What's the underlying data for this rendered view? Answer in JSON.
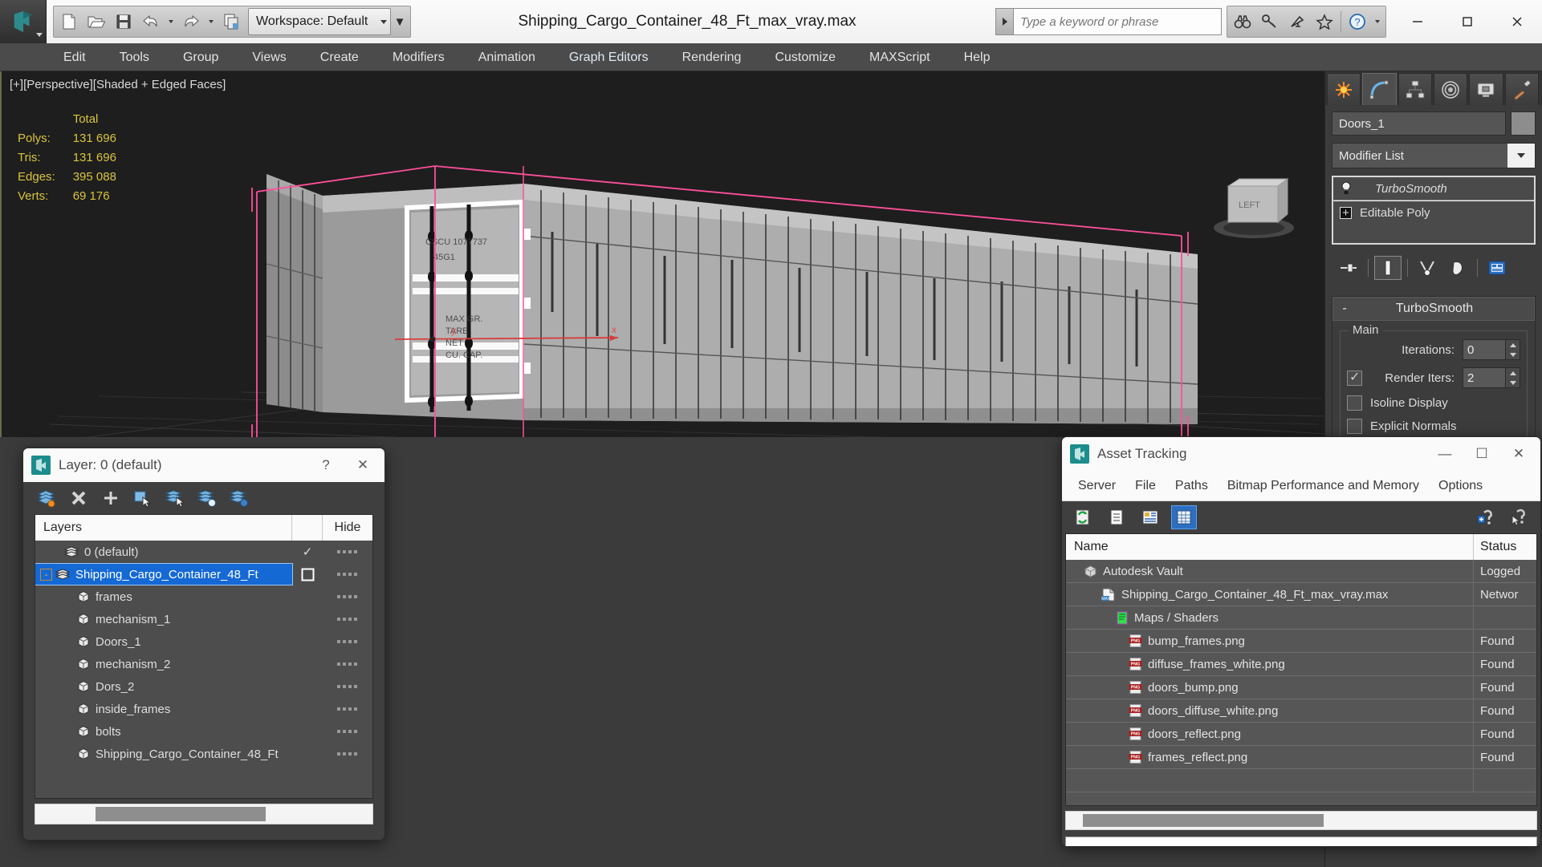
{
  "titlebar": {
    "document_title": "Shipping_Cargo_Container_48_Ft_max_vray.max",
    "workspace_label": "Workspace: Default",
    "search_placeholder": "Type a keyword or phrase",
    "quick_access": [
      "new-file-icon",
      "open-file-icon",
      "save-file-icon",
      "undo-icon",
      "redo-icon",
      "project-folder-icon"
    ],
    "help_icons": [
      "binoculars-icon",
      "key-icon",
      "satellite-dish-icon",
      "star-icon",
      "question-help-icon"
    ],
    "window_controls": [
      "minimize",
      "maximize",
      "close"
    ]
  },
  "menubar": {
    "items": [
      "Edit",
      "Tools",
      "Group",
      "Views",
      "Create",
      "Modifiers",
      "Animation",
      "Graph Editors",
      "Rendering",
      "Customize",
      "MAXScript",
      "Help"
    ]
  },
  "viewport": {
    "label": "[+][Perspective][Shaded + Edged Faces]",
    "stats": {
      "header": "Total",
      "rows": [
        {
          "label": "Polys:",
          "value": "131 696"
        },
        {
          "label": "Tris:",
          "value": "131 696"
        },
        {
          "label": "Edges:",
          "value": "395 088"
        },
        {
          "label": "Verts:",
          "value": "69 176"
        }
      ]
    },
    "axis": {
      "x": "x",
      "y": "y"
    },
    "viewcube_label": "LEFT",
    "selection_color": "#ff4f9a",
    "stat_color": "#d8c43c"
  },
  "command_panel": {
    "tabs": [
      "create-tab-icon",
      "modify-tab-icon",
      "hierarchy-tab-icon",
      "motion-tab-icon",
      "display-tab-icon",
      "utilities-tab-icon"
    ],
    "active_tab_index": 1,
    "object_name": "Doors_1",
    "modifier_list_label": "Modifier List",
    "stack": [
      {
        "label": "TurboSmooth",
        "icon": "lightbulb-icon",
        "italic": true
      },
      {
        "label": "Editable Poly",
        "icon": "plus-box-icon",
        "italic": false
      }
    ],
    "stack_tools": [
      "pin-stack-icon",
      "show-end-result-icon",
      "make-unique-icon",
      "remove-modifier-icon",
      "configure-sets-icon"
    ],
    "rollout": {
      "minus": "-",
      "title": "TurboSmooth",
      "group_label": "Main",
      "iterations_label": "Iterations:",
      "iterations_value": "0",
      "render_iters_label": "Render Iters:",
      "render_iters_value": "2",
      "render_iters_checked": true,
      "isoline_label": "Isoline Display",
      "isoline_checked": false,
      "explicit_label": "Explicit Normals",
      "explicit_checked": false
    }
  },
  "layer_dialog": {
    "title": "Layer: 0 (default)",
    "titlebar_buttons": [
      "?",
      "✕"
    ],
    "tools": [
      "new-layer-icon",
      "delete-layer-icon",
      "add-layer-icon",
      "select-objects-icon",
      "select-highlighted-icon",
      "highlight-selected-icon",
      "layer-properties-icon"
    ],
    "columns": {
      "name": "Layers",
      "hide": "Hide"
    },
    "rows": [
      {
        "name": "0 (default)",
        "icon": "layer-icon",
        "indent": 1,
        "selected": false,
        "check": "✓",
        "expander": null
      },
      {
        "name": "Shipping_Cargo_Container_48_Ft",
        "icon": "layer-icon",
        "indent": 1,
        "selected": true,
        "check": "square",
        "expander": "-"
      },
      {
        "name": "frames",
        "icon": "object-icon",
        "indent": 2,
        "selected": false,
        "check": null,
        "expander": null
      },
      {
        "name": "mechanism_1",
        "icon": "object-icon",
        "indent": 2,
        "selected": false,
        "check": null,
        "expander": null
      },
      {
        "name": "Doors_1",
        "icon": "object-icon",
        "indent": 2,
        "selected": false,
        "check": null,
        "expander": null
      },
      {
        "name": "mechanism_2",
        "icon": "object-icon",
        "indent": 2,
        "selected": false,
        "check": null,
        "expander": null
      },
      {
        "name": "Dors_2",
        "icon": "object-icon",
        "indent": 2,
        "selected": false,
        "check": null,
        "expander": null
      },
      {
        "name": "inside_frames",
        "icon": "object-icon",
        "indent": 2,
        "selected": false,
        "check": null,
        "expander": null
      },
      {
        "name": "bolts",
        "icon": "object-icon",
        "indent": 2,
        "selected": false,
        "check": null,
        "expander": null
      },
      {
        "name": "Shipping_Cargo_Container_48_Ft",
        "icon": "object-icon",
        "indent": 2,
        "selected": false,
        "check": null,
        "expander": null
      }
    ]
  },
  "asset_dialog": {
    "title": "Asset Tracking",
    "menu": [
      "Server",
      "File",
      "Paths",
      "Bitmap Performance and Memory",
      "Options"
    ],
    "tools": [
      "refresh-icon",
      "list-view-icon",
      "detail-view-icon",
      "grid-view-icon"
    ],
    "tools_right": [
      "add-help-icon",
      "help-cursor-icon"
    ],
    "active_tool_index": 3,
    "columns": {
      "name": "Name",
      "status": "Status"
    },
    "rows": [
      {
        "name": "Autodesk Vault",
        "status": "Logged",
        "icon": "vault-icon",
        "indent": 1
      },
      {
        "name": "Shipping_Cargo_Container_48_Ft_max_vray.max",
        "status": "Networ",
        "icon": "max-file-icon",
        "indent": 2
      },
      {
        "name": "Maps / Shaders",
        "status": "",
        "icon": "maps-shaders-icon",
        "indent": 3
      },
      {
        "name": "bump_frames.png",
        "status": "Found",
        "icon": "png-icon",
        "indent": 4
      },
      {
        "name": "diffuse_frames_white.png",
        "status": "Found",
        "icon": "png-icon",
        "indent": 4
      },
      {
        "name": "doors_bump.png",
        "status": "Found",
        "icon": "png-icon",
        "indent": 4
      },
      {
        "name": "doors_diffuse_white.png",
        "status": "Found",
        "icon": "png-icon",
        "indent": 4
      },
      {
        "name": "doors_reflect.png",
        "status": "Found",
        "icon": "png-icon",
        "indent": 4
      },
      {
        "name": "frames_reflect.png",
        "status": "Found",
        "icon": "png-icon",
        "indent": 4
      }
    ]
  }
}
